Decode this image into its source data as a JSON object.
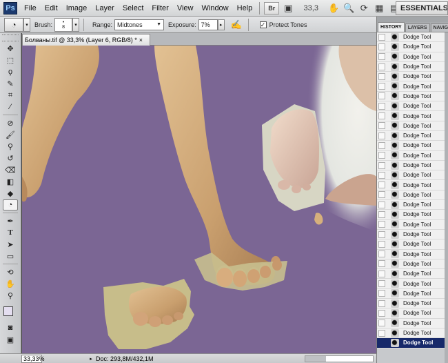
{
  "app": {
    "logo": "Ps"
  },
  "menu": [
    "File",
    "Edit",
    "Image",
    "Layer",
    "Select",
    "Filter",
    "View",
    "Window",
    "Help"
  ],
  "menubar": {
    "bridge_label": "Br",
    "zoom": "33,3",
    "workspace": "ESSENTIALS"
  },
  "options": {
    "brush_label": "Brush:",
    "brush_size": "8",
    "range_label": "Range:",
    "range_value": "Midtones",
    "exposure_label": "Exposure:",
    "exposure_value": "7%",
    "protect_label": "Protect Tones",
    "protect_checked": "✓"
  },
  "document": {
    "tab_title": "Болваны.tif @ 33,3% (Layer 6, RGB/8) *",
    "close": "×",
    "background_color": "#7b6694"
  },
  "status": {
    "zoom": "33,33%",
    "doc_info": "Doc: 293,8M/432,1M"
  },
  "panel": {
    "tabs": [
      "HISTORY",
      "LAYERS",
      "NAVIG"
    ],
    "history_items": [
      "Dodge Tool",
      "Dodge Tool",
      "Dodge Tool",
      "Dodge Tool",
      "Dodge Tool",
      "Dodge Tool",
      "Dodge Tool",
      "Dodge Tool",
      "Dodge Tool",
      "Dodge Tool",
      "Dodge Tool",
      "Dodge Tool",
      "Dodge Tool",
      "Dodge Tool",
      "Dodge Tool",
      "Dodge Tool",
      "Dodge Tool",
      "Dodge Tool",
      "Dodge Tool",
      "Dodge Tool",
      "Dodge Tool",
      "Dodge Tool",
      "Dodge Tool",
      "Dodge Tool",
      "Dodge Tool",
      "Dodge Tool",
      "Dodge Tool",
      "Dodge Tool",
      "Dodge Tool",
      "Dodge Tool",
      "Dodge Tool",
      "Dodge Tool"
    ],
    "selected_index": 31
  },
  "colors": {
    "foreground": "#e4def0",
    "background": "#ffffff",
    "selection": "#17296a"
  }
}
